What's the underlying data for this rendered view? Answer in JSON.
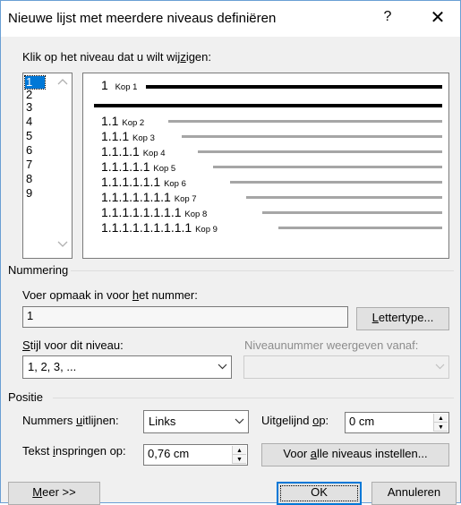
{
  "dialog": {
    "title": "Nieuwe lijst met meerdere niveaus definiëren",
    "help_glyph": "?",
    "close_glyph": "✕"
  },
  "level_picker": {
    "label_pre": "Klik op het niveau dat u wilt wij",
    "label_accel": "z",
    "label_post": "igen:",
    "levels": [
      "1",
      "2",
      "3",
      "4",
      "5",
      "6",
      "7",
      "8",
      "9"
    ],
    "selected": "1"
  },
  "preview": {
    "rows": [
      {
        "number": "1",
        "kop": "Kop 1"
      },
      {
        "number": "1.1",
        "kop": "Kop 2"
      },
      {
        "number": "1.1.1",
        "kop": "Kop 3"
      },
      {
        "number": "1.1.1.1",
        "kop": "Kop 4"
      },
      {
        "number": "1.1.1.1.1",
        "kop": "Kop 5"
      },
      {
        "number": "1.1.1.1.1.1",
        "kop": "Kop 6"
      },
      {
        "number": "1.1.1.1.1.1.1",
        "kop": "Kop 7"
      },
      {
        "number": "1.1.1.1.1.1.1.1",
        "kop": "Kop 8"
      },
      {
        "number": "1.1.1.1.1.1.1.1.1",
        "kop": "Kop 9"
      }
    ]
  },
  "numbering": {
    "group_label": "Nummering",
    "format_label_pre": "Voer opmaak in voor ",
    "format_label_accel": "h",
    "format_label_post": "et nummer:",
    "format_value": "1",
    "font_button_accel": "L",
    "font_button_rest": "ettertype...",
    "style_label_accel": "S",
    "style_label_rest": "tijl voor dit niveau:",
    "style_value": "1, 2, 3, ...",
    "start_from_label": "Niveaunummer weergeven vanaf:",
    "start_from_value": ""
  },
  "position": {
    "group_label": "Positie",
    "align_label_pre": "Nummers ",
    "align_label_accel": "u",
    "align_label_post": "itlijnen:",
    "align_value": "Links",
    "aligned_at_label_pre": "Uitgelijnd ",
    "aligned_at_label_accel": "o",
    "aligned_at_label_post": "p:",
    "aligned_at_value": "0 cm",
    "indent_label_pre": "Tekst ",
    "indent_label_accel": "i",
    "indent_label_post": "nspringen op:",
    "indent_value": "0,76 cm",
    "set_all_pre": "Voor ",
    "set_all_accel": "a",
    "set_all_post": "lle niveaus instellen..."
  },
  "footer": {
    "more_accel": "M",
    "more_rest": "eer >>",
    "ok_label": "OK",
    "cancel_label": "Annuleren"
  }
}
